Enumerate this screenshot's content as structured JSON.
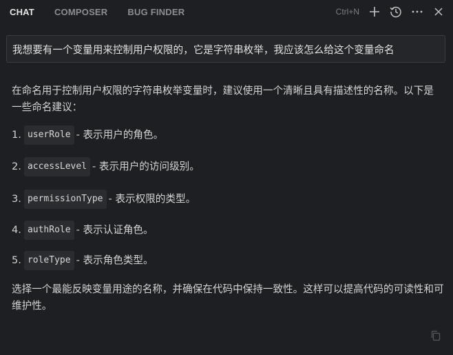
{
  "tabs": [
    {
      "label": "CHAT",
      "active": true
    },
    {
      "label": "COMPOSER",
      "active": false
    },
    {
      "label": "BUG FINDER",
      "active": false
    }
  ],
  "toolbar": {
    "shortcut": "Ctrl+N",
    "icons": [
      "plus-icon",
      "history-icon",
      "more-icon",
      "close-icon"
    ]
  },
  "query": {
    "text": "我想要有一个变量用来控制用户权限的，它是字符串枚举，我应该怎么给这个变量命名"
  },
  "answer": {
    "intro": "在命名用于控制用户权限的字符串枚举变量时，建议使用一个清晰且具有描述性的名称。以下是一些命名建议：",
    "items": [
      {
        "num": "1.",
        "code": "userRole",
        "desc": "- 表示用户的角色。"
      },
      {
        "num": "2.",
        "code": "accessLevel",
        "desc": "- 表示用户的访问级别。"
      },
      {
        "num": "3.",
        "code": "permissionType",
        "desc": "- 表示权限的类型。"
      },
      {
        "num": "4.",
        "code": "authRole",
        "desc": "- 表示认证角色。"
      },
      {
        "num": "5.",
        "code": "roleType",
        "desc": "- 表示角色类型。"
      }
    ],
    "closing": "选择一个最能反映变量用途的名称，并确保在代码中保持一致性。这样可以提高代码的可读性和可维护性。"
  },
  "colors": {
    "background": "#1e1f22",
    "active_tab": "#e6e6e6",
    "inactive_tab": "#8b8d92",
    "code_bg": "#2b2c30"
  }
}
